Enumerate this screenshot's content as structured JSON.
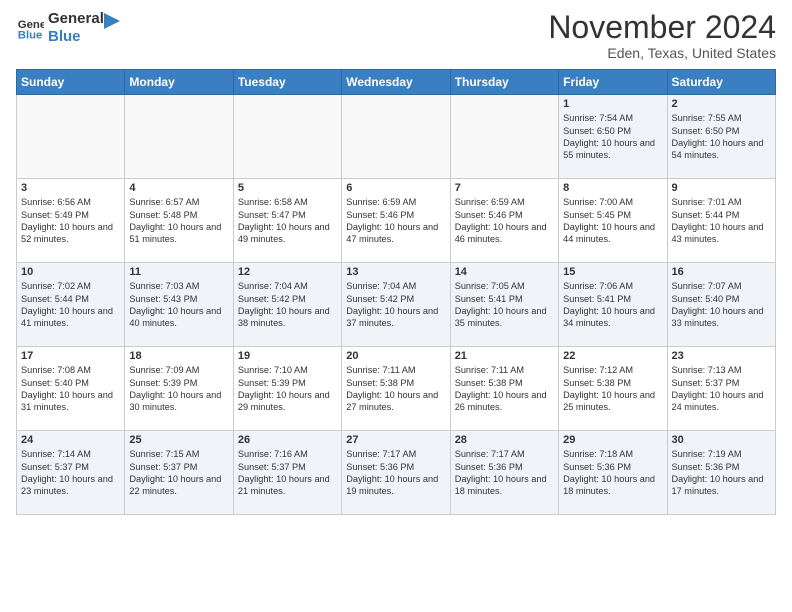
{
  "logo": {
    "line1": "General",
    "line2": "Blue"
  },
  "header": {
    "month": "November 2024",
    "location": "Eden, Texas, United States"
  },
  "days_of_week": [
    "Sunday",
    "Monday",
    "Tuesday",
    "Wednesday",
    "Thursday",
    "Friday",
    "Saturday"
  ],
  "weeks": [
    [
      {
        "day": "",
        "content": ""
      },
      {
        "day": "",
        "content": ""
      },
      {
        "day": "",
        "content": ""
      },
      {
        "day": "",
        "content": ""
      },
      {
        "day": "",
        "content": ""
      },
      {
        "day": "1",
        "content": "Sunrise: 7:54 AM\nSunset: 6:50 PM\nDaylight: 10 hours and 55 minutes."
      },
      {
        "day": "2",
        "content": "Sunrise: 7:55 AM\nSunset: 6:50 PM\nDaylight: 10 hours and 54 minutes."
      }
    ],
    [
      {
        "day": "3",
        "content": "Sunrise: 6:56 AM\nSunset: 5:49 PM\nDaylight: 10 hours and 52 minutes."
      },
      {
        "day": "4",
        "content": "Sunrise: 6:57 AM\nSunset: 5:48 PM\nDaylight: 10 hours and 51 minutes."
      },
      {
        "day": "5",
        "content": "Sunrise: 6:58 AM\nSunset: 5:47 PM\nDaylight: 10 hours and 49 minutes."
      },
      {
        "day": "6",
        "content": "Sunrise: 6:59 AM\nSunset: 5:46 PM\nDaylight: 10 hours and 47 minutes."
      },
      {
        "day": "7",
        "content": "Sunrise: 6:59 AM\nSunset: 5:46 PM\nDaylight: 10 hours and 46 minutes."
      },
      {
        "day": "8",
        "content": "Sunrise: 7:00 AM\nSunset: 5:45 PM\nDaylight: 10 hours and 44 minutes."
      },
      {
        "day": "9",
        "content": "Sunrise: 7:01 AM\nSunset: 5:44 PM\nDaylight: 10 hours and 43 minutes."
      }
    ],
    [
      {
        "day": "10",
        "content": "Sunrise: 7:02 AM\nSunset: 5:44 PM\nDaylight: 10 hours and 41 minutes."
      },
      {
        "day": "11",
        "content": "Sunrise: 7:03 AM\nSunset: 5:43 PM\nDaylight: 10 hours and 40 minutes."
      },
      {
        "day": "12",
        "content": "Sunrise: 7:04 AM\nSunset: 5:42 PM\nDaylight: 10 hours and 38 minutes."
      },
      {
        "day": "13",
        "content": "Sunrise: 7:04 AM\nSunset: 5:42 PM\nDaylight: 10 hours and 37 minutes."
      },
      {
        "day": "14",
        "content": "Sunrise: 7:05 AM\nSunset: 5:41 PM\nDaylight: 10 hours and 35 minutes."
      },
      {
        "day": "15",
        "content": "Sunrise: 7:06 AM\nSunset: 5:41 PM\nDaylight: 10 hours and 34 minutes."
      },
      {
        "day": "16",
        "content": "Sunrise: 7:07 AM\nSunset: 5:40 PM\nDaylight: 10 hours and 33 minutes."
      }
    ],
    [
      {
        "day": "17",
        "content": "Sunrise: 7:08 AM\nSunset: 5:40 PM\nDaylight: 10 hours and 31 minutes."
      },
      {
        "day": "18",
        "content": "Sunrise: 7:09 AM\nSunset: 5:39 PM\nDaylight: 10 hours and 30 minutes."
      },
      {
        "day": "19",
        "content": "Sunrise: 7:10 AM\nSunset: 5:39 PM\nDaylight: 10 hours and 29 minutes."
      },
      {
        "day": "20",
        "content": "Sunrise: 7:11 AM\nSunset: 5:38 PM\nDaylight: 10 hours and 27 minutes."
      },
      {
        "day": "21",
        "content": "Sunrise: 7:11 AM\nSunset: 5:38 PM\nDaylight: 10 hours and 26 minutes."
      },
      {
        "day": "22",
        "content": "Sunrise: 7:12 AM\nSunset: 5:38 PM\nDaylight: 10 hours and 25 minutes."
      },
      {
        "day": "23",
        "content": "Sunrise: 7:13 AM\nSunset: 5:37 PM\nDaylight: 10 hours and 24 minutes."
      }
    ],
    [
      {
        "day": "24",
        "content": "Sunrise: 7:14 AM\nSunset: 5:37 PM\nDaylight: 10 hours and 23 minutes."
      },
      {
        "day": "25",
        "content": "Sunrise: 7:15 AM\nSunset: 5:37 PM\nDaylight: 10 hours and 22 minutes."
      },
      {
        "day": "26",
        "content": "Sunrise: 7:16 AM\nSunset: 5:37 PM\nDaylight: 10 hours and 21 minutes."
      },
      {
        "day": "27",
        "content": "Sunrise: 7:17 AM\nSunset: 5:36 PM\nDaylight: 10 hours and 19 minutes."
      },
      {
        "day": "28",
        "content": "Sunrise: 7:17 AM\nSunset: 5:36 PM\nDaylight: 10 hours and 18 minutes."
      },
      {
        "day": "29",
        "content": "Sunrise: 7:18 AM\nSunset: 5:36 PM\nDaylight: 10 hours and 18 minutes."
      },
      {
        "day": "30",
        "content": "Sunrise: 7:19 AM\nSunset: 5:36 PM\nDaylight: 10 hours and 17 minutes."
      }
    ]
  ]
}
